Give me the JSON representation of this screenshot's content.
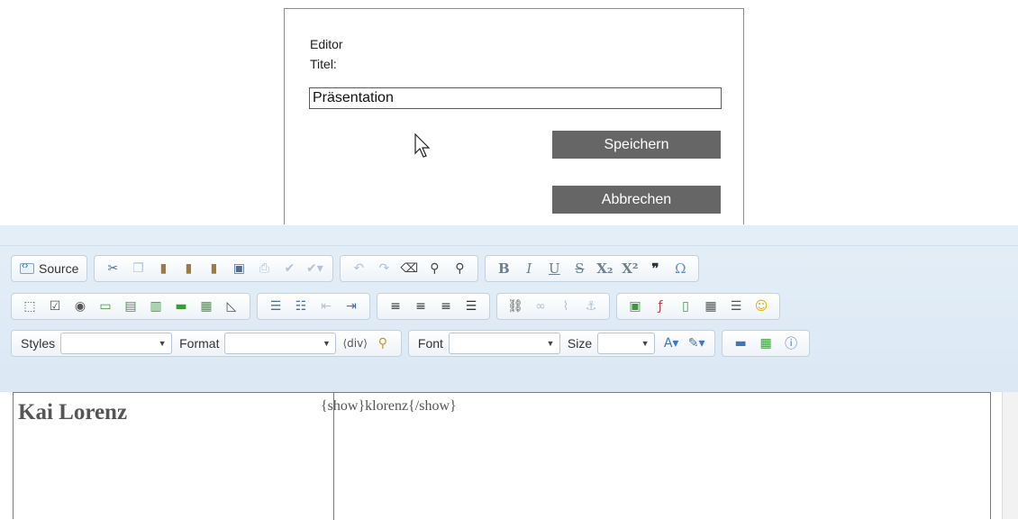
{
  "dialog": {
    "title": "Editor",
    "field_label": "Titel:",
    "title_value": "Präsentation",
    "save_label": "Speichern",
    "cancel_label": "Abbrechen"
  },
  "toolbar": {
    "source_label": "Source",
    "styles_label": "Styles",
    "format_label": "Format",
    "font_label": "Font",
    "size_label": "Size",
    "styles_value": "",
    "format_value": "",
    "font_value": "",
    "size_value": ""
  },
  "content": {
    "name": "Kai Lorenz",
    "code": "{show}klorenz{/show}"
  },
  "colors": {
    "toolbar_bg": "#dbe8f4",
    "button_bg": "#666666",
    "icon_blue": "#4d6e94"
  }
}
